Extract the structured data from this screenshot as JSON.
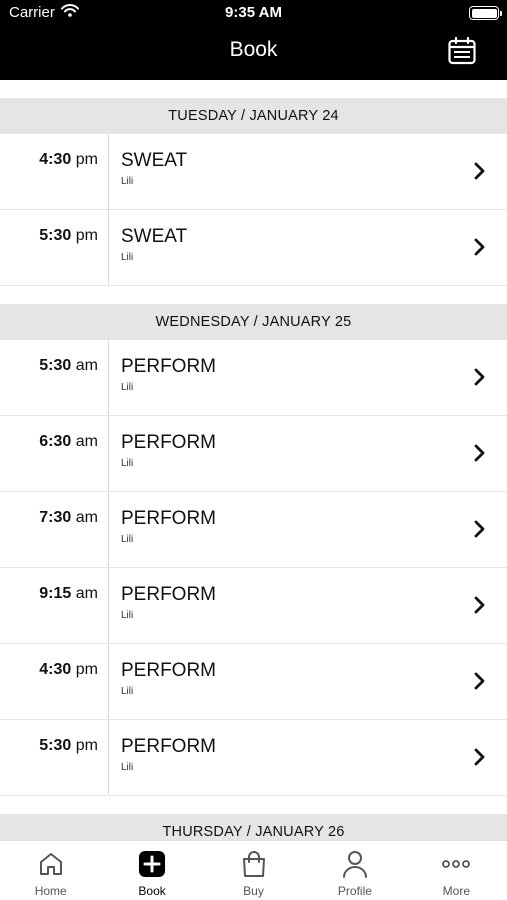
{
  "status_bar": {
    "carrier": "Carrier",
    "time": "9:35 AM"
  },
  "header": {
    "title": "Book",
    "calendar_icon": "calendar-icon"
  },
  "days": [
    {
      "label": "TUESDAY / JANUARY 24",
      "classes": [
        {
          "time": "4:30",
          "ampm": "pm",
          "name": "SWEAT",
          "instructor": "Lili"
        },
        {
          "time": "5:30",
          "ampm": "pm",
          "name": "SWEAT",
          "instructor": "Lili"
        }
      ]
    },
    {
      "label": "WEDNESDAY / JANUARY 25",
      "classes": [
        {
          "time": "5:30",
          "ampm": "am",
          "name": "PERFORM",
          "instructor": "Lili"
        },
        {
          "time": "6:30",
          "ampm": "am",
          "name": "PERFORM",
          "instructor": "Lili"
        },
        {
          "time": "7:30",
          "ampm": "am",
          "name": "PERFORM",
          "instructor": "Lili"
        },
        {
          "time": "9:15",
          "ampm": "am",
          "name": "PERFORM",
          "instructor": "Lili"
        },
        {
          "time": "4:30",
          "ampm": "pm",
          "name": "PERFORM",
          "instructor": "Lili"
        },
        {
          "time": "5:30",
          "ampm": "pm",
          "name": "PERFORM",
          "instructor": "Lili"
        }
      ]
    },
    {
      "label": "THURSDAY / JANUARY 26",
      "classes": []
    }
  ],
  "tabbar": {
    "tabs": [
      {
        "label": "Home",
        "icon": "home-icon",
        "active": false
      },
      {
        "label": "Book",
        "icon": "plus-square-icon",
        "active": true
      },
      {
        "label": "Buy",
        "icon": "shopping-bag-icon",
        "active": false
      },
      {
        "label": "Profile",
        "icon": "person-icon",
        "active": false
      },
      {
        "label": "More",
        "icon": "more-dots-icon",
        "active": false
      }
    ]
  }
}
